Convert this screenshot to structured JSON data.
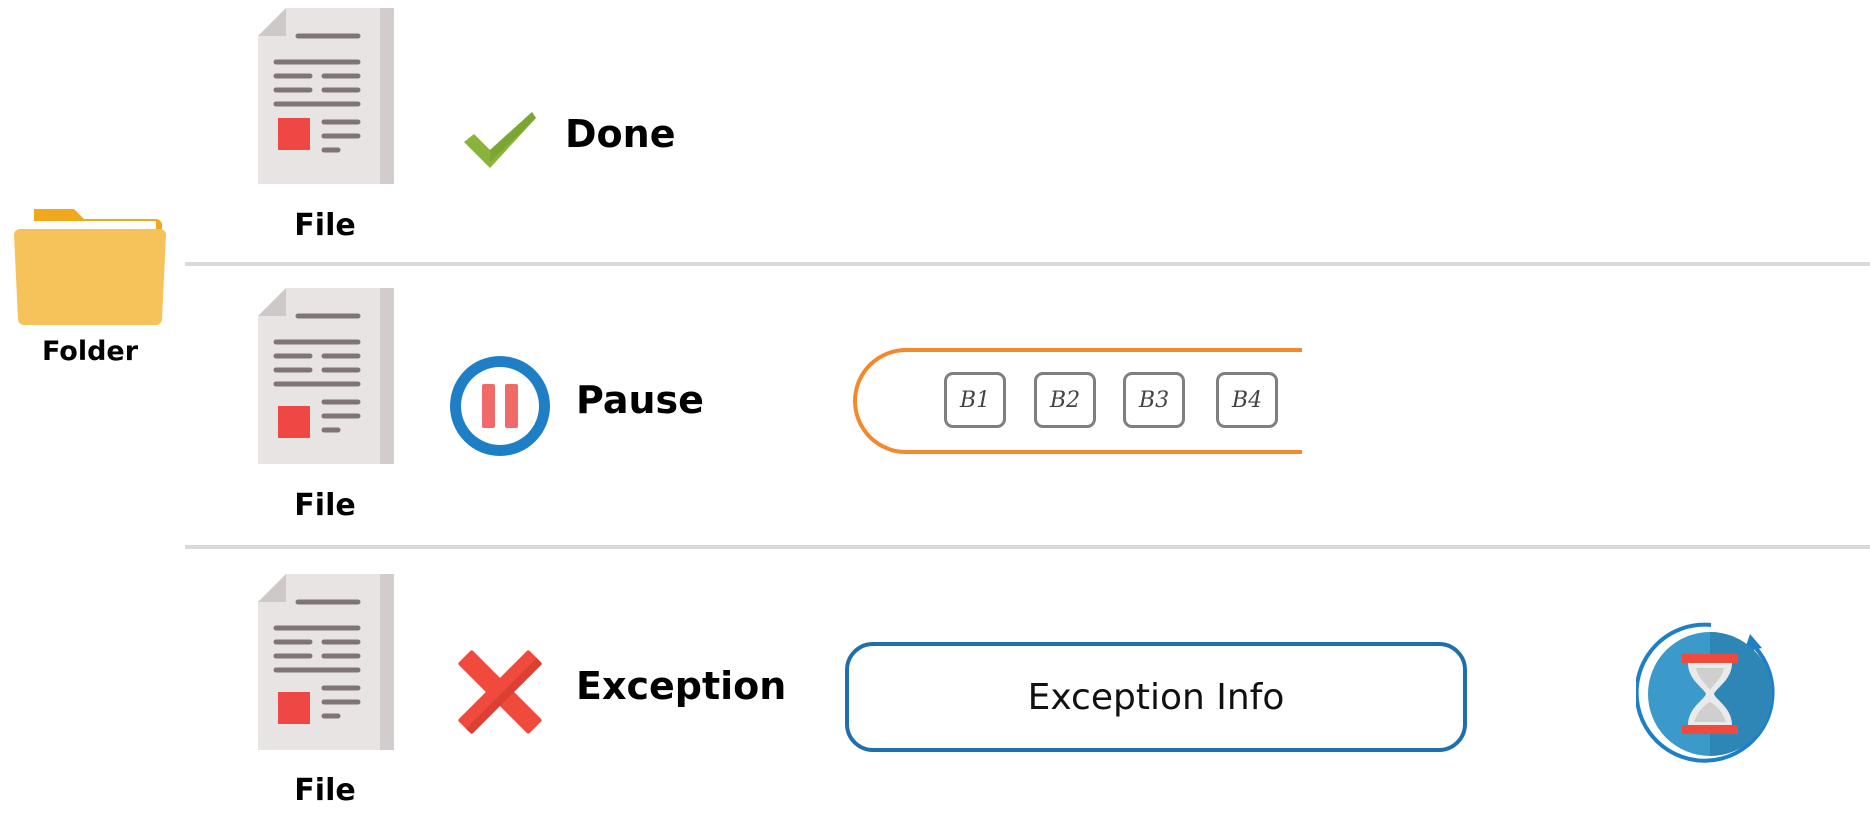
{
  "folder": {
    "label": "Folder",
    "icon": "folder-icon"
  },
  "rows": [
    {
      "file_label": "File",
      "status": "Done",
      "status_icon": "check-icon"
    },
    {
      "file_label": "File",
      "status": "Pause",
      "status_icon": "pause-icon"
    },
    {
      "file_label": "File",
      "status": "Exception",
      "status_icon": "cross-icon"
    }
  ],
  "batches": [
    "B1",
    "B2",
    "B3",
    "B4"
  ],
  "exception_info": "Exception Info",
  "wait_icon": "hourglass-refresh-icon",
  "colors": {
    "divider": "#d9d9d9",
    "folder": "#f6c35a",
    "check": "#8ab33a",
    "pause_ring": "#1e7fc6",
    "pause_bars": "#f06a6a",
    "cross": "#ef4a3c",
    "queue_outline": "#f4892c",
    "exception_border": "#1f6fad",
    "hourglass_bg": "#3b9ac9"
  }
}
